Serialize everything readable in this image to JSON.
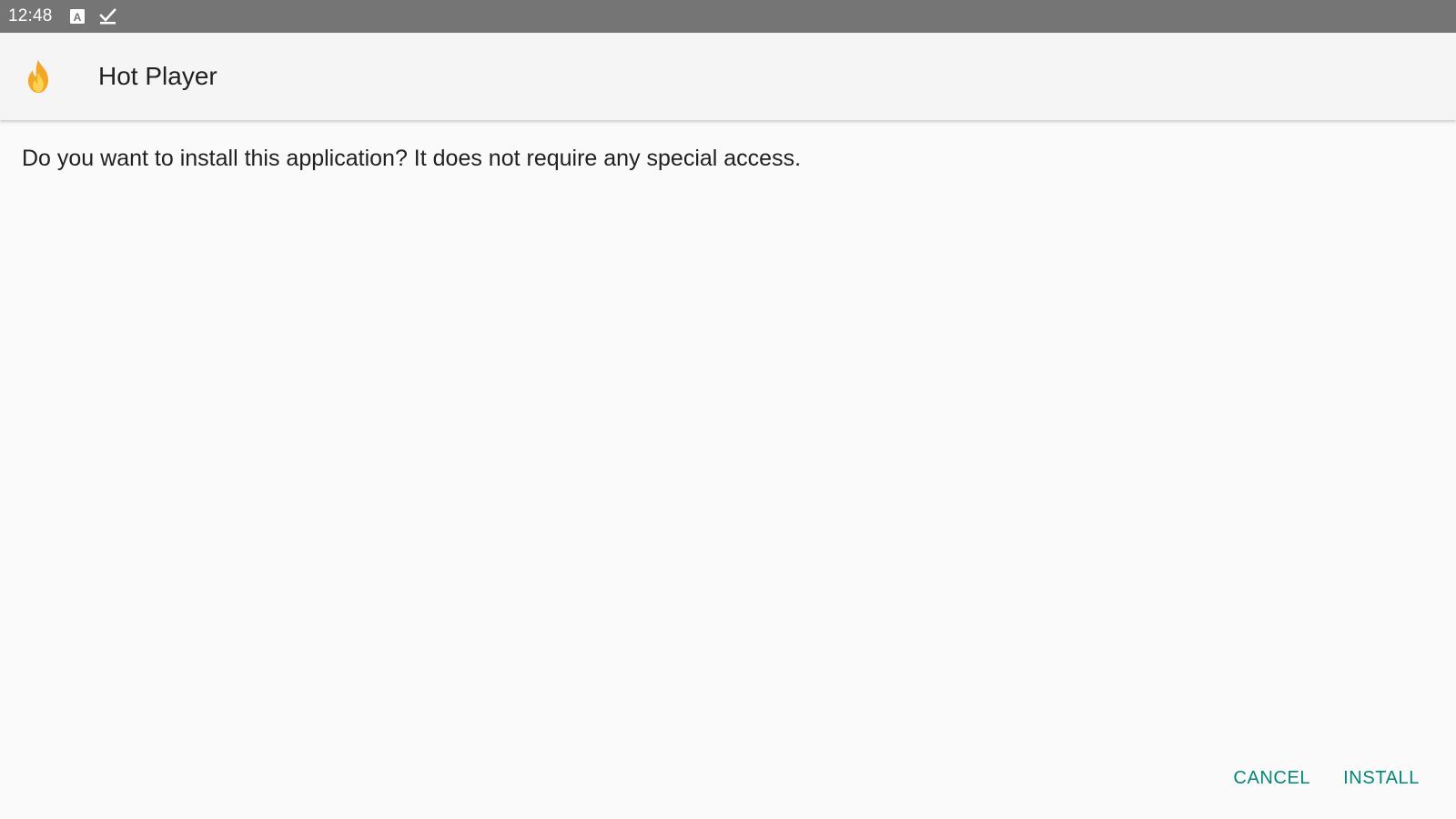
{
  "status_bar": {
    "time": "12:48",
    "icons": [
      "text-box-icon",
      "check-download-icon"
    ],
    "color": "#757575"
  },
  "header": {
    "app_icon": "flame-icon",
    "title": "Hot Player",
    "color": "#f5f5f5"
  },
  "body": {
    "message": "Do you want to install this application? It does not require any special access."
  },
  "actions": {
    "cancel_label": "CANCEL",
    "install_label": "INSTALL",
    "accent_color": "#00897b"
  }
}
